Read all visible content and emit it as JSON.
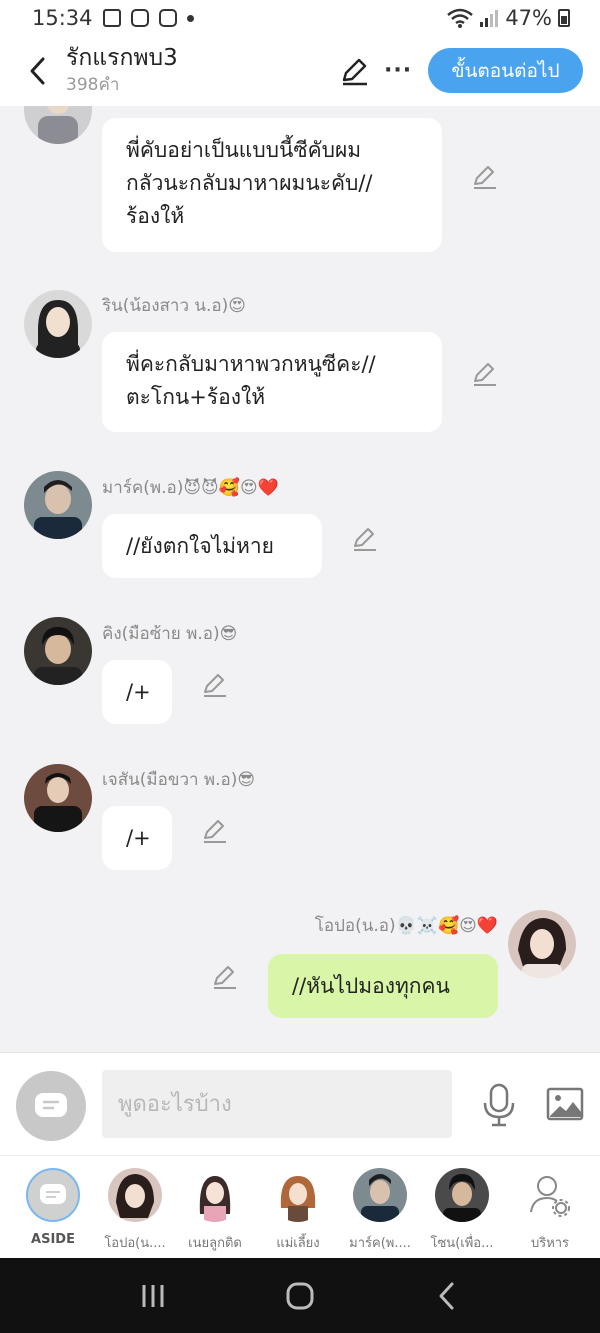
{
  "status_bar": {
    "time": "15:34",
    "battery": "47%"
  },
  "header": {
    "title": "รักแรกพบ3",
    "word_count": "398คำ",
    "next_button": "ขั้นตอนต่อไป"
  },
  "messages": [
    {
      "sender": "",
      "text_lines": [
        "พี่คับอย่าเป็นแบบนี้ซีคับผม",
        "กลัวนะกลับมาหาผมนะคับ//",
        "ร้องให้"
      ]
    },
    {
      "sender": "ริน(น้องสาว น.อ)😍",
      "text_lines": [
        "พี่คะกลับมาหาพวกหนูซีคะ//",
        "ตะโกน+ร้องให้"
      ]
    },
    {
      "sender": "มาร์ค(พ.อ)😈😈🥰😍❤️",
      "text_lines": [
        "//ยังตกใจไม่หาย"
      ]
    },
    {
      "sender": "คิง(มือซ้าย พ.อ)😎",
      "text_lines": [
        "/+"
      ]
    },
    {
      "sender": "เจสัน(มือขวา พ.อ)😎",
      "text_lines": [
        "/+"
      ]
    },
    {
      "sender": "โอปอ(น.อ)💀☠️🥰😍❤️",
      "text_lines": [
        "//หันไปมองทุกคน"
      ]
    }
  ],
  "input": {
    "placeholder": "พูดอะไรบ้าง"
  },
  "tray": {
    "items": [
      {
        "label": "ASIDE"
      },
      {
        "label": "โอปอ(น...."
      },
      {
        "label": "เนยลูกติด"
      },
      {
        "label": "แม่เลี้ยง"
      },
      {
        "label": "มาร์ค(พ...."
      },
      {
        "label": "โซน(เพื่อ..."
      },
      {
        "label": "บริหาร"
      }
    ]
  },
  "colors": {
    "accent": "#4aa3ee",
    "my_bubble": "#d9f5a8",
    "bubble": "#ffffff",
    "background": "#f2f2f4"
  }
}
